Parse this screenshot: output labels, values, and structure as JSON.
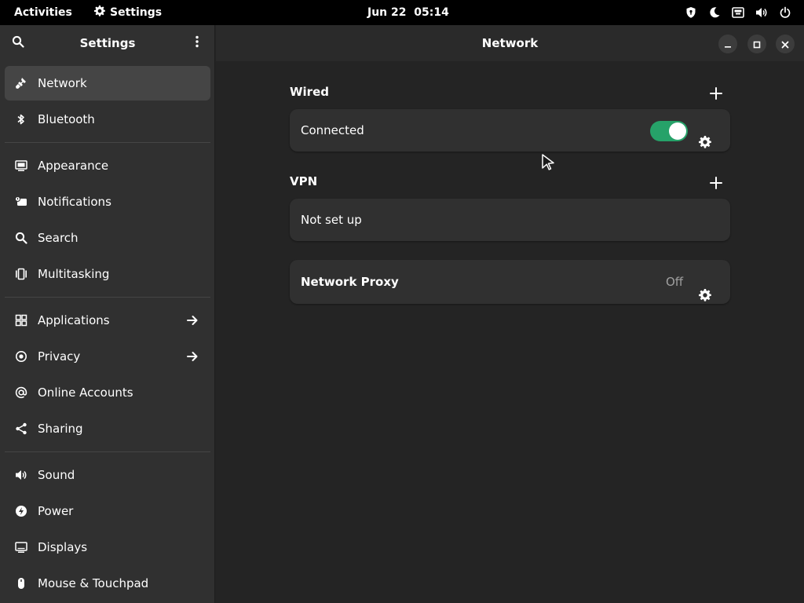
{
  "topbar": {
    "activities": "Activities",
    "app_name": "Settings",
    "clock": "Jun 22  05:14",
    "tray_icons": [
      "shield-icon",
      "night-light-icon",
      "network-wired-icon",
      "volume-icon",
      "power-icon"
    ]
  },
  "sidebar": {
    "title": "Settings",
    "items": [
      {
        "label": "Network",
        "icon": "network-icon",
        "active": true
      },
      {
        "label": "Bluetooth",
        "icon": "bluetooth-icon"
      },
      {
        "label": "Appearance",
        "icon": "appearance-icon"
      },
      {
        "label": "Notifications",
        "icon": "notifications-icon"
      },
      {
        "label": "Search",
        "icon": "search-icon"
      },
      {
        "label": "Multitasking",
        "icon": "multitasking-icon"
      },
      {
        "label": "Applications",
        "icon": "applications-icon",
        "has_arrow": true
      },
      {
        "label": "Privacy",
        "icon": "privacy-icon",
        "has_arrow": true
      },
      {
        "label": "Online Accounts",
        "icon": "online-accounts-icon"
      },
      {
        "label": "Sharing",
        "icon": "sharing-icon"
      },
      {
        "label": "Sound",
        "icon": "sound-icon"
      },
      {
        "label": "Power",
        "icon": "power-icon"
      },
      {
        "label": "Displays",
        "icon": "displays-icon"
      },
      {
        "label": "Mouse & Touchpad",
        "icon": "mouse-icon"
      }
    ]
  },
  "main": {
    "title": "Network",
    "wired": {
      "heading": "Wired",
      "status": "Connected",
      "enabled": true
    },
    "vpn": {
      "heading": "VPN",
      "status": "Not set up"
    },
    "proxy": {
      "label": "Network Proxy",
      "value": "Off"
    }
  },
  "colors": {
    "accent_toggle": "#26a269",
    "sidebar_bg": "#303030",
    "content_bg": "#242424",
    "topbar_bg": "#000000"
  }
}
